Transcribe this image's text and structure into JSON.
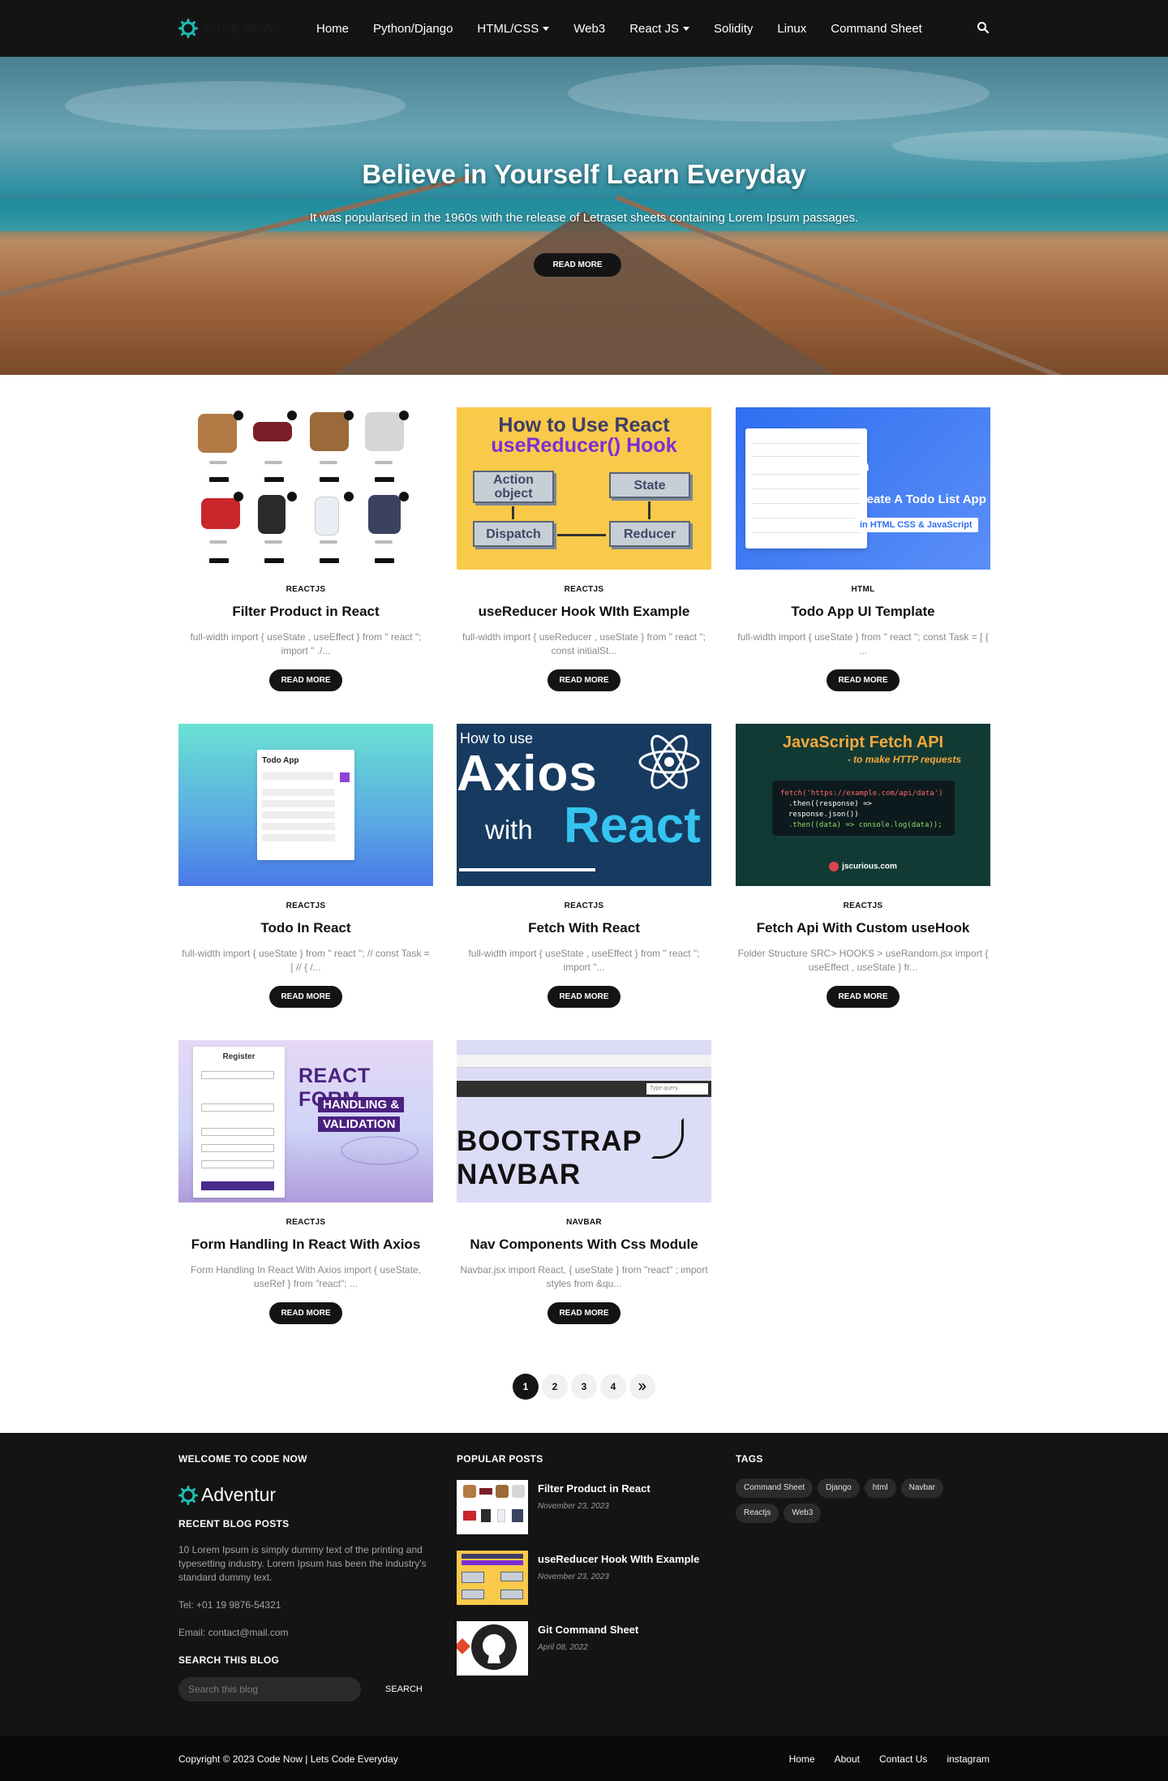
{
  "brand": {
    "name": "CODE NOW"
  },
  "nav": {
    "items": [
      {
        "label": "Home",
        "dropdown": false
      },
      {
        "label": "Python/Django",
        "dropdown": false
      },
      {
        "label": "HTML/CSS",
        "dropdown": true
      },
      {
        "label": "Web3",
        "dropdown": false
      },
      {
        "label": "React JS",
        "dropdown": true
      },
      {
        "label": "Solidity",
        "dropdown": false
      },
      {
        "label": "Linux",
        "dropdown": false
      },
      {
        "label": "Command Sheet",
        "dropdown": false
      }
    ],
    "search_icon": "search-icon"
  },
  "hero": {
    "title": "Believe in Yourself Learn Everyday",
    "subtitle": "It was popularised in the 1960s with the release of Letraset sheets containing Lorem Ipsum passages.",
    "button": "READ MORE"
  },
  "posts": [
    {
      "category": "REACTJS",
      "title": "Filter Product in React",
      "excerpt": "full-width import { useState , useEffect } from \" react \"; import \" ./...",
      "button": "READ MORE"
    },
    {
      "category": "REACTJS",
      "title": "useReducer Hook WIth Example",
      "excerpt": "full-width import { useReducer , useState } from \" react \"; const initialSt...",
      "button": "READ MORE",
      "thumb": {
        "line1": "How to Use React",
        "line2": "useReducer() Hook",
        "box1": "Action object",
        "box2": "State",
        "box3": "Dispatch",
        "box4": "Reducer"
      }
    },
    {
      "category": "HTML",
      "title": "Todo App UI Template",
      "excerpt": "full-width   import { useState } from \" react \"; const Task = [ { ...",
      "button": "READ MORE",
      "thumb": {
        "heading": "Create A Todo List App",
        "tag": "in HTML CSS & JavaScript"
      }
    },
    {
      "category": "REACTJS",
      "title": "Todo In React",
      "excerpt": "full-width   import { useState } from \" react \"; // const Task = [ // { /...",
      "button": "READ MORE",
      "thumb": {
        "heading": "Todo App"
      }
    },
    {
      "category": "REACTJS",
      "title": "Fetch With React",
      "excerpt": "full-width   import { useState , useEffect } from \" react \"; import \"...",
      "button": "READ MORE",
      "thumb": {
        "line1": "How to use",
        "line2": "Axios",
        "line3": "with",
        "line4": "React"
      }
    },
    {
      "category": "REACTJS",
      "title": "Fetch Api With Custom useHook",
      "excerpt": "Folder Structure  SRC> HOOKS > useRandom.jsx  import { useEffect , useState } fr...",
      "button": "READ MORE",
      "thumb": {
        "heading": "JavaScript Fetch API",
        "sub": "- to make HTTP requests",
        "code1": "fetch('https://example.com/api/data')",
        "code2": ".then((response) => response.json())",
        "code3": ".then((data) => console.log(data));",
        "brand": "jscurious.com"
      }
    },
    {
      "category": "REACTJS",
      "title": "Form Handling In React With Axios",
      "excerpt": "Form Handling In React With Axios import { useState, useRef } from \"react\"; ...",
      "button": "READ MORE",
      "thumb": {
        "panel": "Register",
        "big": "REACT FORM",
        "chip1": "HANDLING &",
        "chip2": "VALIDATION"
      }
    },
    {
      "category": "NAVBAR",
      "title": "Nav Components With Css Module",
      "excerpt": "Navbar.jsx import React, { useState } from \"react\" ; import styles from &qu...",
      "button": "READ MORE",
      "thumb": {
        "line1": "BOOTSTRAP",
        "line2": "NAVBAR",
        "query": "Type query"
      }
    }
  ],
  "pagination": {
    "pages": [
      "1",
      "2",
      "3",
      "4"
    ],
    "active": "1",
    "next_icon": "double-chevron-right-icon"
  },
  "footer": {
    "welcome_heading": "WELCOME TO CODE NOW",
    "brand": "Adventur",
    "recent_heading": "RECENT BLOG POSTS",
    "about": "10 Lorem Ipsum is simply dummy text of the printing and typesetting industry. Lorem Ipsum has been the industry's standard dummy text.",
    "tel": "Tel: +01 19 9876-54321",
    "email": "Email: contact@mail.com",
    "search_heading": "SEARCH THIS BLOG",
    "search_placeholder": "Search this blog",
    "search_button": "SEARCH",
    "popular_heading": "POPULAR POSTS",
    "popular": [
      {
        "title": "Filter Product in React",
        "date": "November 23, 2023"
      },
      {
        "title": "useReducer Hook WIth Example",
        "date": "November 23, 2023"
      },
      {
        "title": "Git Command Sheet",
        "date": "April 08, 2022"
      }
    ],
    "tags_heading": "TAGS",
    "tags": [
      "Command Sheet",
      "Django",
      "html",
      "Navbar",
      "Reactjs",
      "Web3"
    ]
  },
  "bottom": {
    "copyright": "Copyright © 2023 Code Now | Lets Code Everyday",
    "links": [
      "Home",
      "About",
      "Contact Us",
      "instagram"
    ]
  },
  "colors": {
    "nav_bg": "#141414",
    "accent": "#1bbfb0",
    "button": "#141414",
    "footer_bg": "#141414"
  }
}
